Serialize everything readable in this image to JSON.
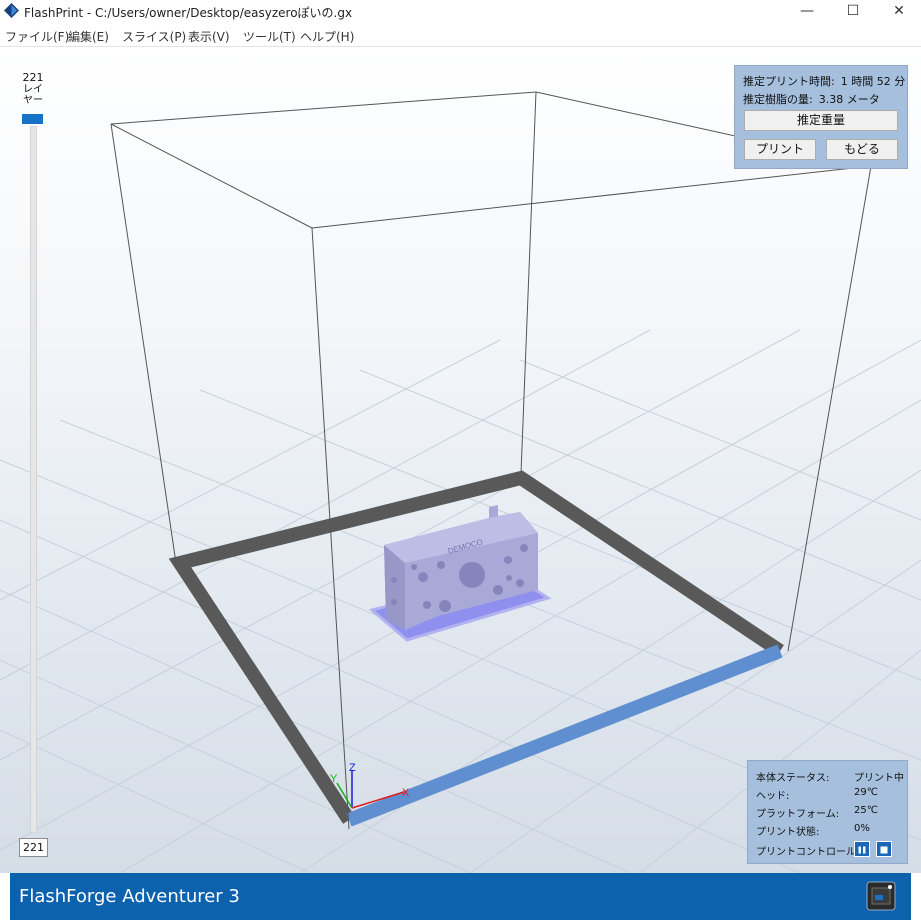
{
  "window": {
    "title": "FlashPrint - C:/Users/owner/Desktop/easyzeroぽいの.gx",
    "min_glyph": "—",
    "max_glyph": "☐",
    "close_glyph": "✕"
  },
  "menu": [
    {
      "label": "ファイル(F)"
    },
    {
      "label": "編集(E)"
    },
    {
      "label": "スライス(P)"
    },
    {
      "label": "表示(V)"
    },
    {
      "label": "ツール(T)"
    },
    {
      "label": "ヘルプ(H)"
    }
  ],
  "layer_slider": {
    "top_value": "221",
    "label_lines": "レイヤー",
    "current_value": "221"
  },
  "estimate": {
    "time_label": "推定プリント時間:",
    "time_value": "1 時間 52 分",
    "resin_label": "推定樹脂の量:",
    "resin_value": "3.38 メータ",
    "weight_button": "推定重量",
    "print_button": "プリント",
    "back_button": "もどる"
  },
  "status": {
    "rows": [
      {
        "label": "本体ステータス:",
        "value": "プリント中"
      },
      {
        "label": "ヘッド:",
        "value": "29℃"
      },
      {
        "label": "プラットフォーム:",
        "value": "25℃"
      },
      {
        "label": "プリント状態:",
        "value": "0%"
      }
    ],
    "control_label": "プリントコントロール:"
  },
  "axes": {
    "x": "X",
    "y": "Y",
    "z": "Z"
  },
  "model": {
    "engraved_text": "DEMOCO"
  },
  "machine": {
    "name": "FlashForge Adventurer 3"
  },
  "colors": {
    "accent": "#0d62ae",
    "panel": "#a5bfdc",
    "model": "#a9a9d8",
    "raft": "#8f8ff0",
    "bed_edge_dark": "#555555",
    "bed_edge_front": "#5f8fd0"
  }
}
